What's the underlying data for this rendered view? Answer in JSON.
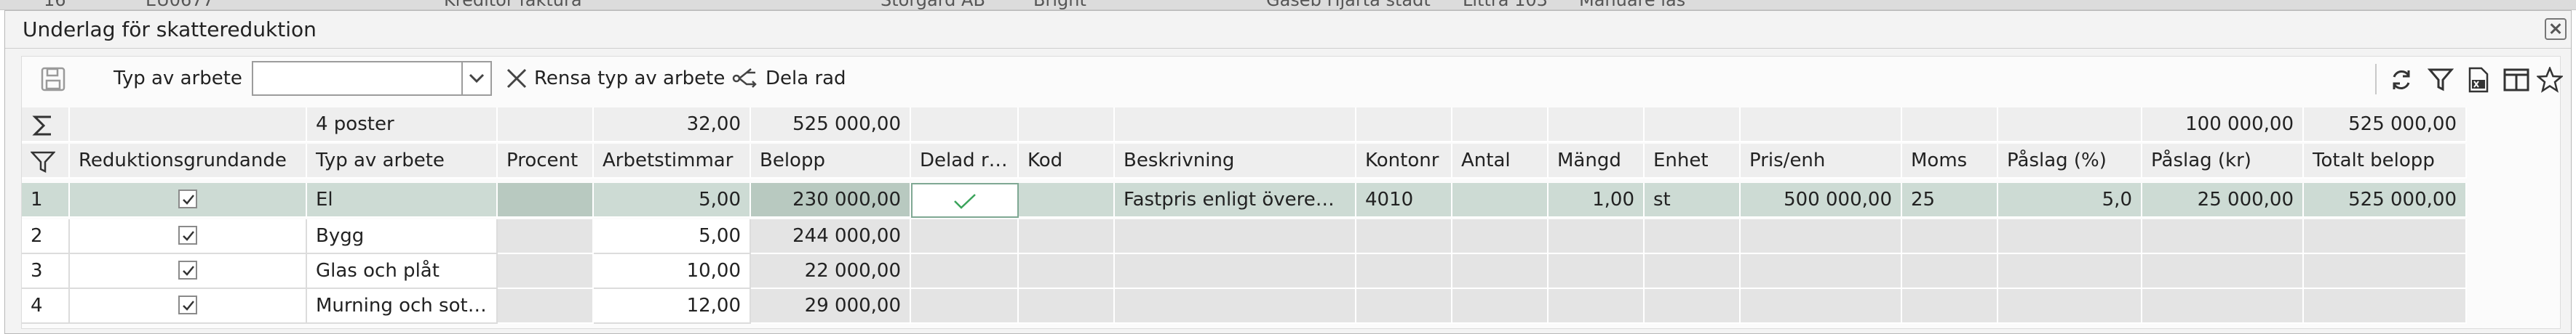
{
  "background_strip": {
    "fragments": [
      "16",
      "EU0677",
      "Kreditor faktura",
      "Storgard AB",
      "Bright",
      "Gäseb Hjarta stadt",
      "Littra 103",
      "Manuare las"
    ]
  },
  "dialog": {
    "title": "Underlag för skattereduktion",
    "close_icon": "close-icon"
  },
  "toolbar": {
    "save_icon": "floppy-disk-icon",
    "work_type_label": "Typ av arbete",
    "work_type_value": "",
    "clear_label": "Rensa typ av arbete",
    "split_label": "Dela rad",
    "right_icons": [
      "refresh-icon",
      "filter-icon",
      "excel-export-icon",
      "columns-icon",
      "favorite-star-icon"
    ]
  },
  "summary": {
    "count": "4 poster",
    "hours_total": "32,00",
    "amount_total": "525 000,00",
    "markup_total": "100 000,00",
    "grand_total": "525 000,00"
  },
  "columns": [
    "Reduktionsgrundande",
    "Typ av arbete",
    "Procent",
    "Arbetstimmar",
    "Belopp",
    "Delad rad",
    "Kod",
    "Beskrivning",
    "Kontonr",
    "Antal",
    "Mängd",
    "Enhet",
    "Pris/enh",
    "Moms",
    "Påslag (%)",
    "Påslag (kr)",
    "Totalt belopp"
  ],
  "rows": [
    {
      "num": "1",
      "checked": true,
      "type": "El",
      "procent": "",
      "hours": "5,00",
      "amount": "230 000,00",
      "split": true,
      "kod": "",
      "desc": "Fastpris enligt överenskommelse",
      "konto": "4010",
      "antal": "",
      "mangd": "1,00",
      "enhet": "st",
      "pris": "500 000,00",
      "moms": "25",
      "paslag_pct": "5,0",
      "paslag_kr": "25 000,00",
      "total": "525 000,00"
    },
    {
      "num": "2",
      "checked": true,
      "type": "Bygg",
      "procent": "",
      "hours": "5,00",
      "amount": "244 000,00"
    },
    {
      "num": "3",
      "checked": true,
      "type": "Glas och plåt",
      "procent": "",
      "hours": "10,00",
      "amount": "22 000,00"
    },
    {
      "num": "4",
      "checked": true,
      "type": "Murning och sotning",
      "procent": "",
      "hours": "12,00",
      "amount": "29 000,00"
    }
  ]
}
